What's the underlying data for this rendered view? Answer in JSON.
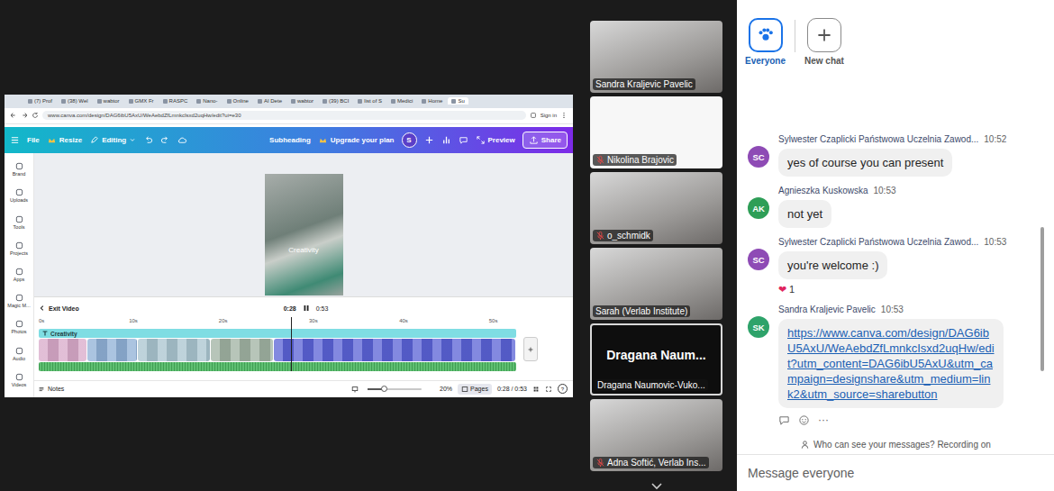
{
  "browser": {
    "tabs": [
      {
        "label": "(7) Prof",
        "selected": false
      },
      {
        "label": "(38) Wel",
        "selected": false
      },
      {
        "label": "wabtor",
        "selected": false
      },
      {
        "label": "GMX Fr",
        "selected": false
      },
      {
        "label": "RASPC",
        "selected": false
      },
      {
        "label": "Nano-",
        "selected": false
      },
      {
        "label": "Online",
        "selected": false
      },
      {
        "label": "AI Dete",
        "selected": false
      },
      {
        "label": "wabtor",
        "selected": false
      },
      {
        "label": "(39) BCI",
        "selected": false
      },
      {
        "label": "list of S",
        "selected": false
      },
      {
        "label": "Medici",
        "selected": false
      },
      {
        "label": "Home",
        "selected": false
      },
      {
        "label": "Su",
        "selected": true
      }
    ],
    "url": "www.canva.com/design/DAG6ibU5AxU/WeAebdZfLmnkcIsxd2uqHw/edit?ui=e30",
    "sign_in": "Sign in"
  },
  "canva": {
    "menu": {
      "file": "File",
      "resize": "Resize",
      "editing": "Editing",
      "subheading": "Subheading",
      "upgrade": "Upgrade your plan",
      "avatar": "S",
      "preview": "Preview",
      "share": "Share"
    },
    "sidebar": [
      {
        "label": "Brand"
      },
      {
        "label": "Uploads"
      },
      {
        "label": "Tools"
      },
      {
        "label": "Projects"
      },
      {
        "label": "Apps"
      },
      {
        "label": "Magic M..."
      },
      {
        "label": "Photos"
      },
      {
        "label": "Audio"
      },
      {
        "label": "Videos"
      }
    ],
    "design_text": "Creativity",
    "timeline": {
      "exit": "Exit Video",
      "current": "0:28",
      "total": "0:53",
      "playing": true,
      "playhead": 0.528,
      "ticks": [
        {
          "label": "0s",
          "level": 0
        },
        {
          "label": "10s",
          "level": 0.189
        },
        {
          "label": "20s",
          "level": 0.377
        },
        {
          "label": "30s",
          "level": 0.566
        },
        {
          "label": "40s",
          "level": 0.755
        },
        {
          "label": "50s",
          "level": 0.943
        }
      ],
      "text_track": "Creativity",
      "clips": [
        {
          "color": "#d8a9c9",
          "level": 0.1
        },
        {
          "color": "#8fb0d6",
          "level": 0.104
        },
        {
          "color": "#a9c4cf",
          "level": 0.15
        },
        {
          "color": "#9fb2a2",
          "level": 0.13
        },
        {
          "color": "#5a62d6",
          "level": 0.506
        }
      ]
    },
    "footer": {
      "notes": "Notes",
      "zoom": "20%",
      "zoom_level": 0.3,
      "pages": "Pages",
      "time": "0:28 / 0:53",
      "help": "?"
    }
  },
  "participants": [
    {
      "name": "Sandra Kraljevic Pavelic",
      "muted": false,
      "speaking": false,
      "kind": "video"
    },
    {
      "name": "Nikolina Brajovic",
      "muted": true,
      "speaking": false,
      "kind": "logo"
    },
    {
      "name": "o_schmidk",
      "muted": true,
      "speaking": false,
      "kind": "video"
    },
    {
      "name": "Sarah (Verlab Institute)",
      "muted": false,
      "speaking": false,
      "kind": "video"
    },
    {
      "name": "Dragana Naumovic-Vuko...",
      "muted": false,
      "speaking": true,
      "kind": "name",
      "display_name": "Dragana Naum..."
    },
    {
      "name": "Adna Softić, Verlab Ins...",
      "muted": true,
      "speaking": false,
      "kind": "video"
    }
  ],
  "chat": {
    "tabs": [
      {
        "label": "Everyone",
        "selected": true
      },
      {
        "label": "New chat",
        "selected": false
      }
    ],
    "messages": [
      {
        "initials": "SC",
        "name": "Sylwester Czaplicki Państwowa Uczelnia Zawod...",
        "time": "10:52",
        "kind": "text",
        "text": "yes of course you can present",
        "color": "#8e4bb5",
        "reactions": [],
        "hovered": false
      },
      {
        "initials": "AK",
        "name": "Agnieszka Kuskowska",
        "time": "10:53",
        "kind": "text",
        "text": "not yet",
        "color": "#2e9e57",
        "reactions": [],
        "hovered": false
      },
      {
        "initials": "SC",
        "name": "Sylwester Czaplicki Państwowa Uczelnia Zawod...",
        "time": "10:53",
        "kind": "text",
        "text": "you're welcome :)",
        "color": "#8e4bb5",
        "reactions": [
          {
            "emoji": "❤",
            "count": "1"
          }
        ],
        "hovered": false
      },
      {
        "initials": "SK",
        "name": "Sandra Kraljevic Pavelic",
        "time": "10:53",
        "kind": "link",
        "text": "https://www.canva.com/design/DAG6ibU5AxU/WeAebdZfLmnkcIsxd2uqHw/edit?utm_content=DAG6ibU5AxU&utm_campaign=designshare&utm_medium=link2&utm_source=sharebutton",
        "color": "#2ea36a",
        "reactions": [],
        "hovered": true
      }
    ],
    "more": "···",
    "notice": "Who can see your messages? Recording on",
    "input": {
      "placeholder": "Message everyone"
    }
  }
}
